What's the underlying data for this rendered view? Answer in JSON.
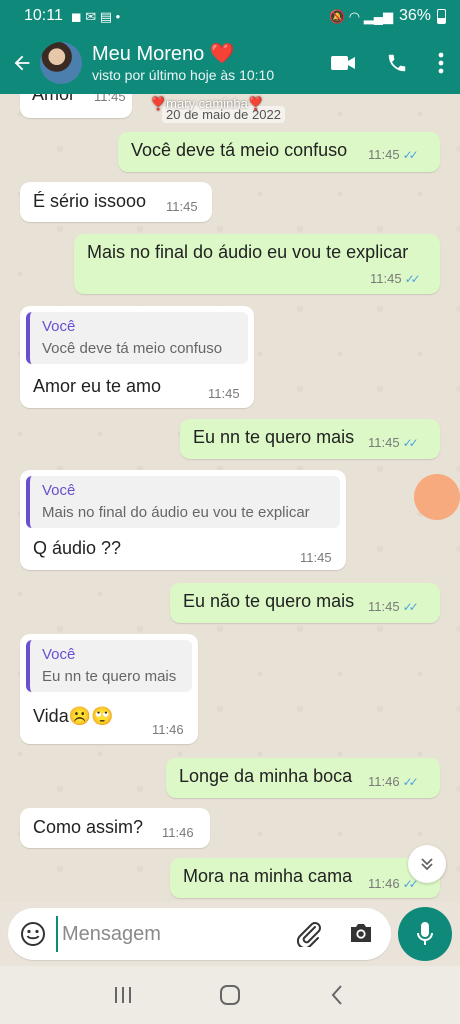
{
  "status_bar": {
    "time": "10:11",
    "battery": "36%"
  },
  "header": {
    "contact_name": "Meu Moreno ❤️",
    "last_seen": "visto por último hoje às 10:10",
    "icons": [
      "back-arrow-icon",
      "video-call-icon",
      "phone-icon",
      "more-vert-icon"
    ]
  },
  "chat": {
    "date_chip": "20 de maio de 2022",
    "wallpaper_text": "❣️mary caminha❣️",
    "partial_message": {
      "text": "Amor",
      "time": "11:45"
    },
    "messages": [
      {
        "dir": "out",
        "text": "Você deve tá meio confuso",
        "time": "11:45"
      },
      {
        "dir": "in",
        "text": "É sério issooo",
        "time": "11:45"
      },
      {
        "dir": "out",
        "text": "Mais no final do áudio eu vou te explicar",
        "time": "11:45"
      },
      {
        "dir": "in",
        "quote_author": "Você",
        "quote_text": "Você deve tá meio confuso",
        "text": "Amor eu te amo",
        "time": "11:45"
      },
      {
        "dir": "out",
        "text": "Eu nn te quero mais",
        "time": "11:45"
      },
      {
        "dir": "in",
        "quote_author": "Você",
        "quote_text": "Mais no final do áudio eu vou te explicar",
        "text": "Q áudio ??",
        "time": "11:45"
      },
      {
        "dir": "out",
        "text": "Eu não te quero mais",
        "time": "11:45"
      },
      {
        "dir": "in",
        "quote_author": "Você",
        "quote_text": "Eu nn te quero mais",
        "text": "Vida☹️🙄",
        "time": "11:46"
      },
      {
        "dir": "out",
        "text": "Longe da minha boca",
        "time": "11:46"
      },
      {
        "dir": "in",
        "text": "Como assim?",
        "time": "11:46"
      },
      {
        "dir": "out",
        "text": "Mora na minha cama",
        "time": "11:46"
      }
    ],
    "read_receipt": "✓✓"
  },
  "composer": {
    "placeholder": "Mensagem"
  },
  "colors": {
    "header": "#0f8a7a",
    "outgoing": "#dcf8c6",
    "incoming": "#ffffff",
    "ticks": "#4fa3e0"
  }
}
